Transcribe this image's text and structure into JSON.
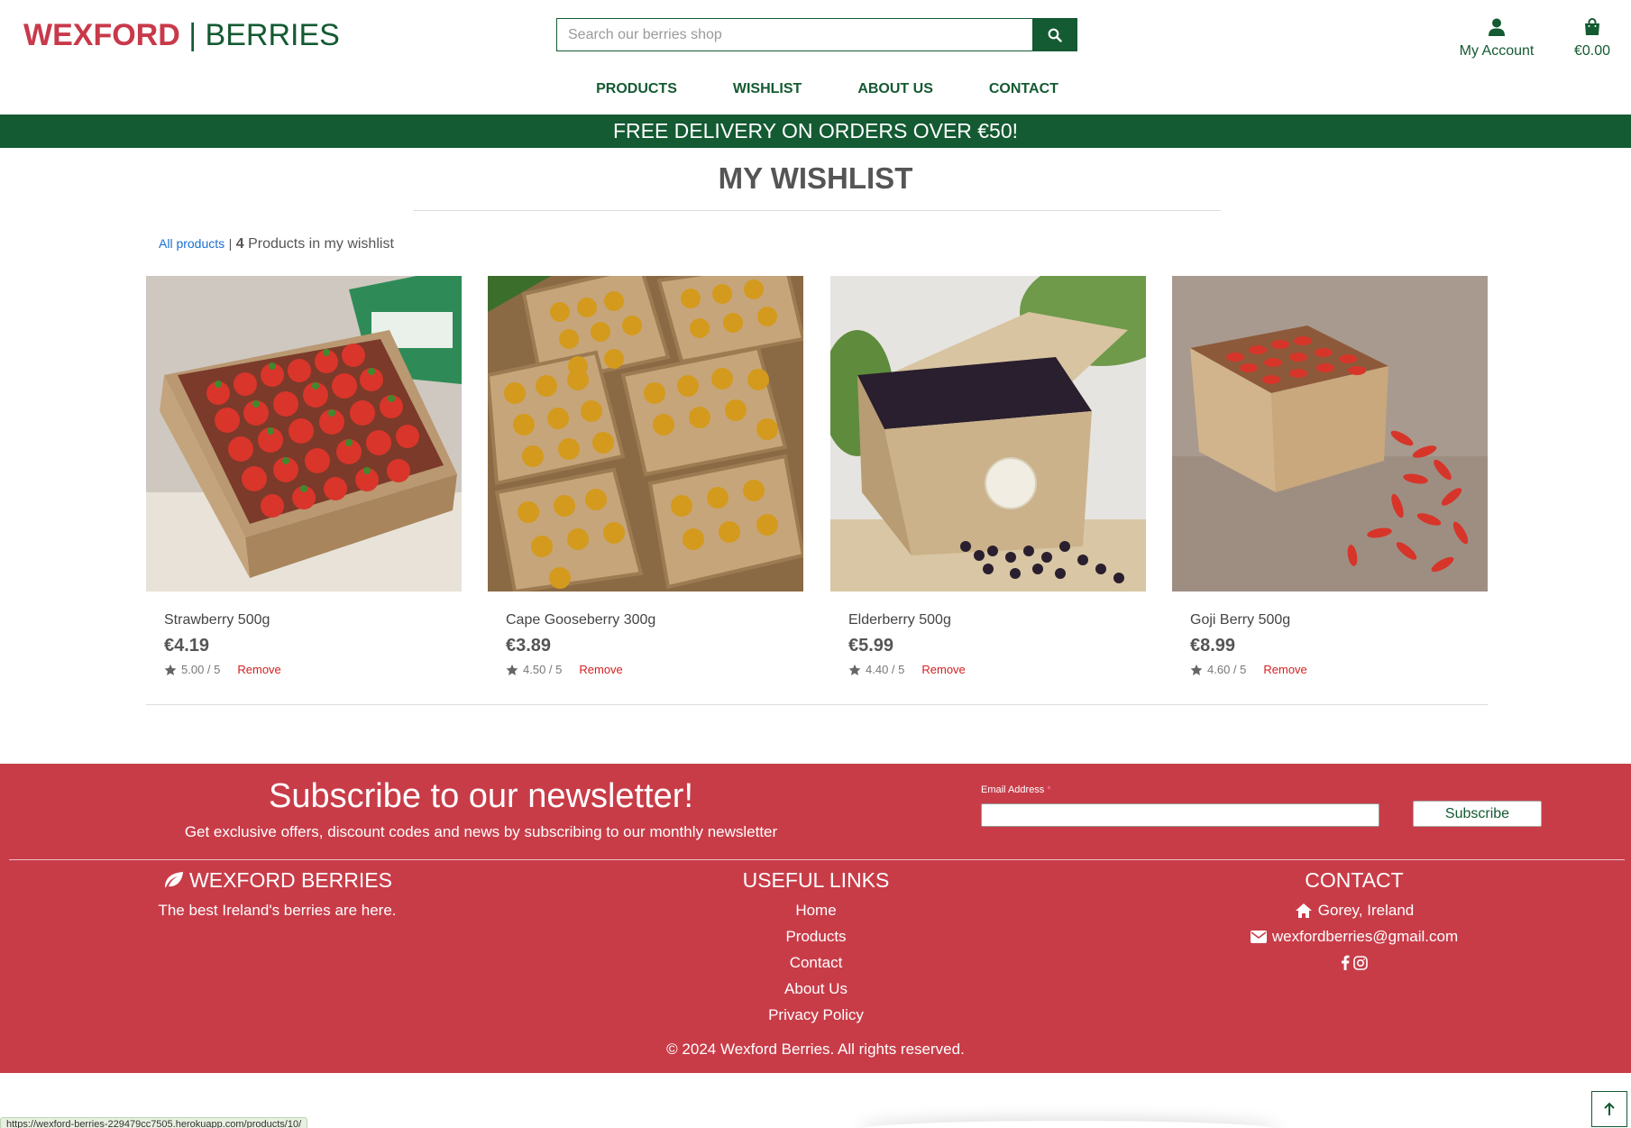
{
  "header": {
    "logo_left": "WEXFORD",
    "logo_sep": "|",
    "logo_right": "BERRIES",
    "search_placeholder": "Search our berries shop",
    "account_label": "My Account",
    "cart_total": "€0.00"
  },
  "nav": [
    {
      "label": "PRODUCTS"
    },
    {
      "label": "WISHLIST"
    },
    {
      "label": "ABOUT US"
    },
    {
      "label": "CONTACT"
    }
  ],
  "banner": "FREE DELIVERY ON ORDERS OVER €50!",
  "page_title": "MY WISHLIST",
  "summary": {
    "all_products_link": "All products",
    "separator": "|",
    "count": "4",
    "count_text": "Products in my wishlist"
  },
  "products": [
    {
      "name": "Strawberry 500g",
      "price": "€4.19",
      "rating": "5.00 / 5",
      "remove": "Remove",
      "image": "strawberry-box"
    },
    {
      "name": "Cape Gooseberry 300g",
      "price": "€3.89",
      "rating": "4.50 / 5",
      "remove": "Remove",
      "image": "gooseberry-trays"
    },
    {
      "name": "Elderberry 500g",
      "price": "€5.99",
      "rating": "4.40 / 5",
      "remove": "Remove",
      "image": "elderberry-box"
    },
    {
      "name": "Goji Berry 500g",
      "price": "€8.99",
      "rating": "4.60 / 5",
      "remove": "Remove",
      "image": "goji-box"
    }
  ],
  "newsletter": {
    "title": "Subscribe to our newsletter!",
    "subtitle": "Get exclusive offers, discount codes and news by subscribing to our monthly newsletter",
    "email_label": "Email Address",
    "required_mark": "*",
    "button": "Subscribe"
  },
  "footer": {
    "brand_title": "WEXFORD BERRIES",
    "brand_tagline": "The best Ireland's berries are here.",
    "links_title": "USEFUL LINKS",
    "links": [
      {
        "label": "Home"
      },
      {
        "label": "Products"
      },
      {
        "label": "Contact"
      },
      {
        "label": "About Us"
      },
      {
        "label": "Privacy Policy"
      }
    ],
    "contact_title": "CONTACT",
    "location": "Gorey, Ireland",
    "email": "wexfordberries@gmail.com",
    "copyright": "© 2024 Wexford Berries. All rights reserved."
  },
  "status_bar_url": "https://wexford-berries-229479cc7505.herokuapp.com/products/10/",
  "colors": {
    "brand_green": "#145a32",
    "brand_red": "#c83c48",
    "logo_red": "#c8394a",
    "link_blue": "#1a6fd1",
    "remove_red": "#d42020"
  }
}
